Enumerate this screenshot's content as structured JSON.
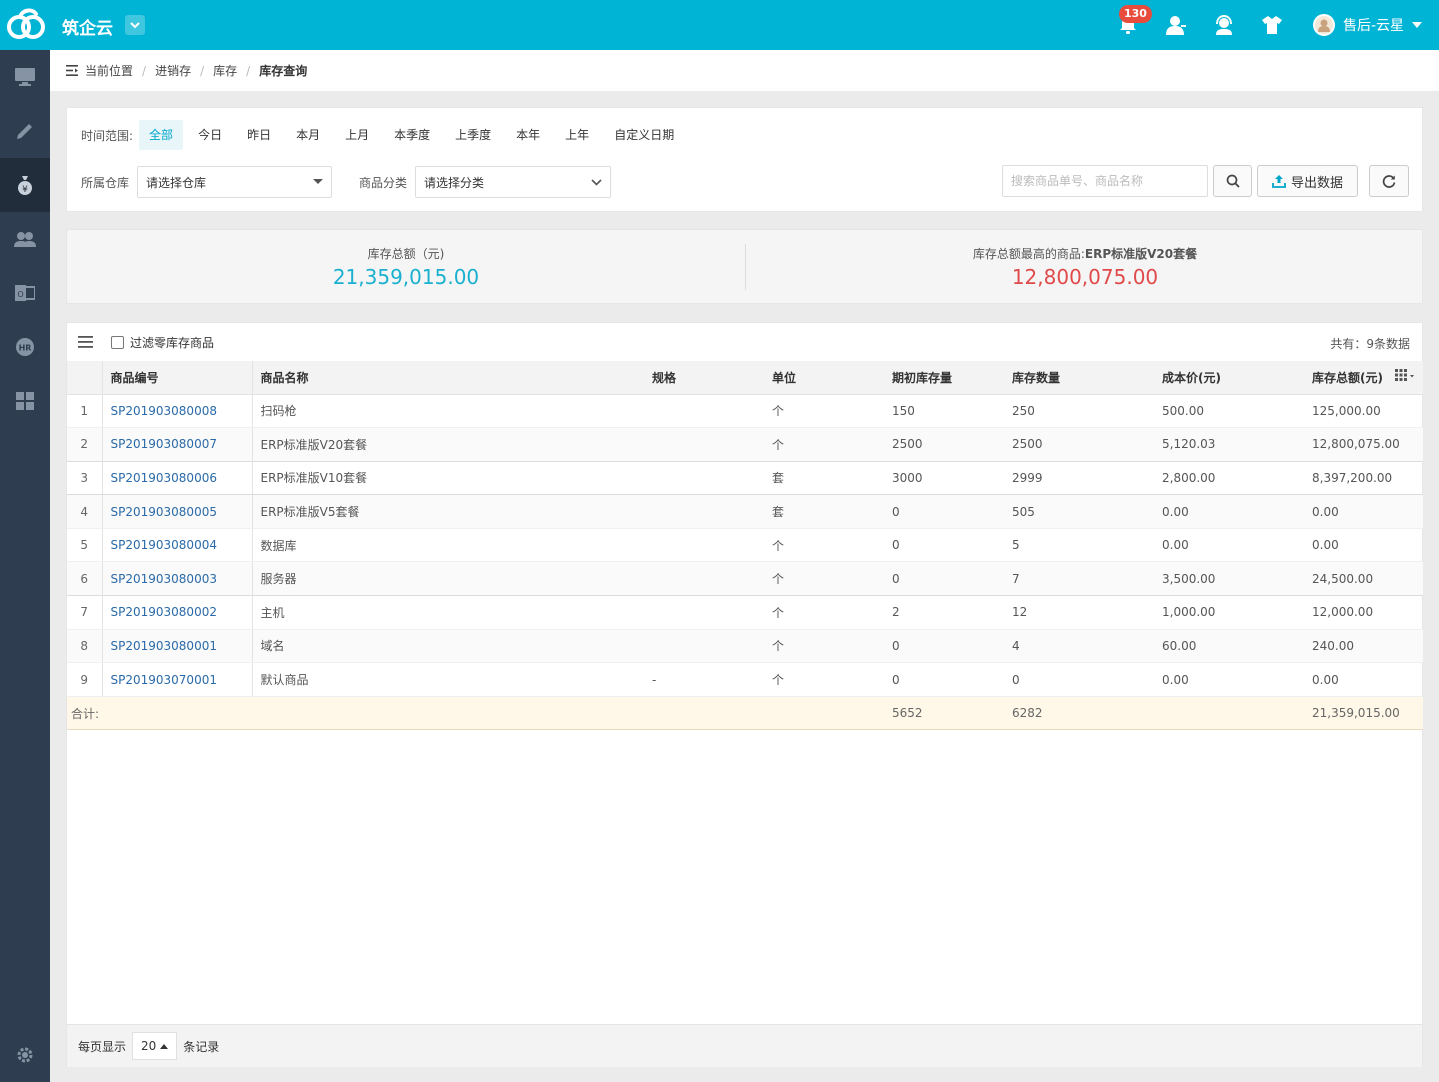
{
  "header": {
    "app_title": "筑企云",
    "notification_count": "130",
    "user_name": "售后-云星"
  },
  "sidebar": {
    "items": [
      {
        "icon": "monitor-icon"
      },
      {
        "icon": "pencil-icon"
      },
      {
        "icon": "money-bag-icon"
      },
      {
        "icon": "users-icon"
      },
      {
        "icon": "office-icon"
      },
      {
        "icon": "hr-icon"
      },
      {
        "icon": "grid-icon"
      }
    ],
    "settings_icon": "gear-icon"
  },
  "breadcrumb": {
    "prefix": "当前位置",
    "items": [
      "进销存",
      "库存"
    ],
    "current": "库存查询"
  },
  "filters": {
    "time_label": "时间范围:",
    "time_options": [
      "全部",
      "今日",
      "昨日",
      "本月",
      "上月",
      "本季度",
      "上季度",
      "本年",
      "上年",
      "自定义日期"
    ],
    "active_time_option": "全部",
    "warehouse_label": "所属仓库",
    "warehouse_value": "请选择仓库",
    "category_label": "商品分类",
    "category_value": "请选择分类",
    "search_placeholder": "搜索商品单号、商品名称",
    "export_label": "导出数据"
  },
  "summary": {
    "total_label": "库存总额（元)",
    "total_value": "21,359,015.00",
    "top_label_prefix": "库存总额最高的商品:",
    "top_product": "ERP标准版V20套餐",
    "top_value": "12,800,075.00",
    "colors": {
      "total": "#1ab0cf",
      "top": "#e04a4a"
    }
  },
  "table": {
    "filter_zero_label": "过滤零库存商品",
    "total_count": "共有：9条数据",
    "columns": [
      "商品编号",
      "商品名称",
      "规格",
      "单位",
      "期初库存量",
      "库存数量",
      "成本价(元)",
      "库存总额(元)"
    ],
    "rows": [
      {
        "idx": "1",
        "code": "SP201903080008",
        "name": "扫码枪",
        "spec": "",
        "unit": "个",
        "initial": "150",
        "qty": "250",
        "cost": "500.00",
        "total": "125,000.00"
      },
      {
        "idx": "2",
        "code": "SP201903080007",
        "name": "ERP标准版V20套餐",
        "spec": "",
        "unit": "个",
        "initial": "2500",
        "qty": "2500",
        "cost": "5,120.03",
        "total": "12,800,075.00"
      },
      {
        "idx": "3",
        "code": "SP201903080006",
        "name": "ERP标准版V10套餐",
        "spec": "",
        "unit": "套",
        "initial": "3000",
        "qty": "2999",
        "cost": "2,800.00",
        "total": "8,397,200.00"
      },
      {
        "idx": "4",
        "code": "SP201903080005",
        "name": "ERP标准版V5套餐",
        "spec": "",
        "unit": "套",
        "initial": "0",
        "qty": "505",
        "cost": "0.00",
        "total": "0.00"
      },
      {
        "idx": "5",
        "code": "SP201903080004",
        "name": "数据库",
        "spec": "",
        "unit": "个",
        "initial": "0",
        "qty": "5",
        "cost": "0.00",
        "total": "0.00"
      },
      {
        "idx": "6",
        "code": "SP201903080003",
        "name": "服务器",
        "spec": "",
        "unit": "个",
        "initial": "0",
        "qty": "7",
        "cost": "3,500.00",
        "total": "24,500.00"
      },
      {
        "idx": "7",
        "code": "SP201903080002",
        "name": "主机",
        "spec": "",
        "unit": "个",
        "initial": "2",
        "qty": "12",
        "cost": "1,000.00",
        "total": "12,000.00"
      },
      {
        "idx": "8",
        "code": "SP201903080001",
        "name": "域名",
        "spec": "",
        "unit": "个",
        "initial": "0",
        "qty": "4",
        "cost": "60.00",
        "total": "240.00"
      },
      {
        "idx": "9",
        "code": "SP201903070001",
        "name": "默认商品",
        "spec": "-",
        "unit": "个",
        "initial": "0",
        "qty": "0",
        "cost": "0.00",
        "total": "0.00"
      }
    ],
    "sum_row": {
      "label": "合计:",
      "initial": "5652",
      "qty": "6282",
      "total": "21,359,015.00"
    }
  },
  "pager": {
    "prefix": "每页显示",
    "page_size": "20",
    "suffix": "条记录"
  },
  "colors": {
    "topbar": "#00b4d6",
    "sidebar": "#2f3d50",
    "accent": "#00a6c9",
    "link": "#2a6aa8"
  }
}
